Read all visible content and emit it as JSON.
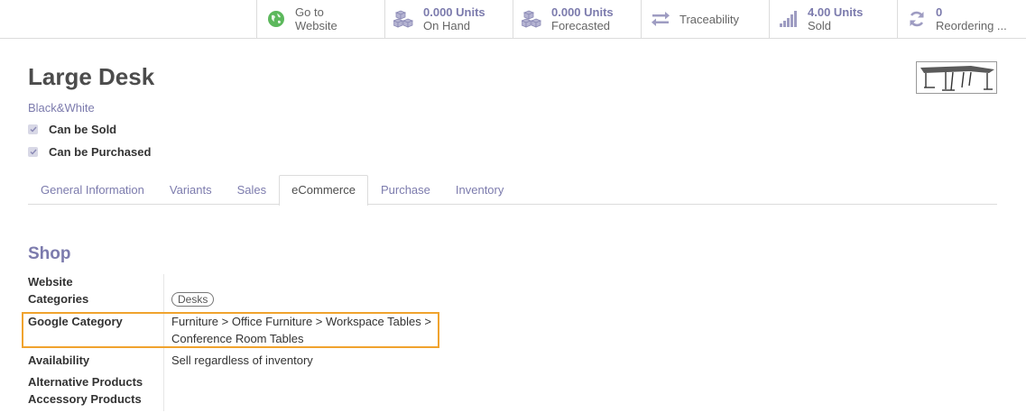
{
  "smart_buttons": [
    {
      "icon": "globe-icon",
      "value": "",
      "label_line1": "Go to",
      "label_line2": "Website",
      "icon_color": "#5cb85c"
    },
    {
      "icon": "cubes-icon",
      "value": "0.000 Units",
      "label_line2": "On Hand",
      "icon_color": "#9e9cc2"
    },
    {
      "icon": "cubes-icon",
      "value": "0.000 Units",
      "label_line2": "Forecasted",
      "icon_color": "#9e9cc2"
    },
    {
      "icon": "exchange-icon",
      "label": "Traceability",
      "icon_color": "#9e9cc2"
    },
    {
      "icon": "signal-icon",
      "value": "4.00 Units",
      "label_line2": "Sold",
      "icon_color": "#9e9cc2"
    },
    {
      "icon": "refresh-icon",
      "value": "0",
      "label_line2": "Reordering ...",
      "icon_color": "#9e9cc2"
    }
  ],
  "product": {
    "name": "Large Desk",
    "variant": "Black&White",
    "can_be_sold": "Can be Sold",
    "can_be_purchased": "Can be Purchased"
  },
  "tabs": [
    {
      "label": "General Information",
      "active": false
    },
    {
      "label": "Variants",
      "active": false
    },
    {
      "label": "Sales",
      "active": false
    },
    {
      "label": "eCommerce",
      "active": true
    },
    {
      "label": "Purchase",
      "active": false
    },
    {
      "label": "Inventory",
      "active": false
    }
  ],
  "shop": {
    "title": "Shop",
    "website_label": "Website",
    "categories_label": "Categories",
    "categories_tag": "Desks",
    "google_category_label": "Google Category",
    "google_category_line1": "Furniture > Office Furniture > Workspace Tables >",
    "google_category_line2": "Conference Room Tables",
    "availability_label": "Availability",
    "availability_value": "Sell regardless of inventory",
    "alternative_products_label": "Alternative Products",
    "accessory_products_label": "Accessory Products"
  },
  "colors": {
    "accent": "#7c7bad",
    "highlight": "#f0a32e"
  }
}
